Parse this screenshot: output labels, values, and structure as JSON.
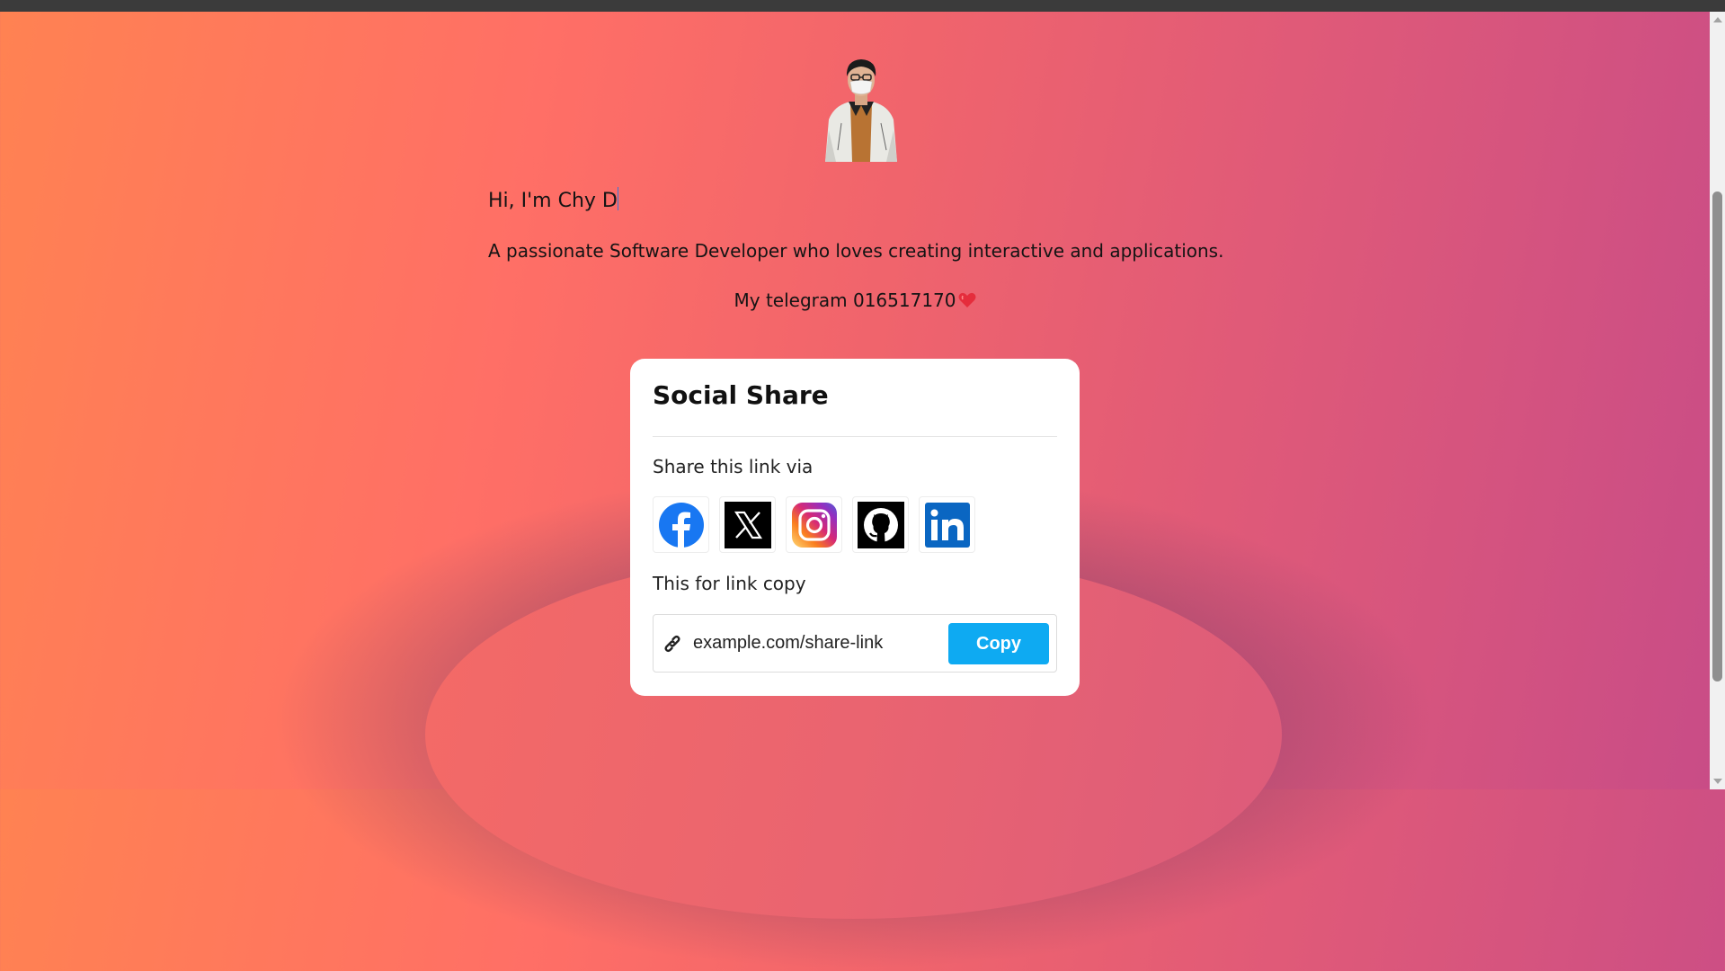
{
  "hero": {
    "greeting": "Hi, I'm Chy D",
    "bio": "A passionate Software Developer who loves creating interactive and applications.",
    "telegram": "My telegram 016517170"
  },
  "card": {
    "title": "Social Share",
    "share_label": "Share this link via",
    "icons": [
      "facebook-icon",
      "x-twitter-icon",
      "instagram-icon",
      "github-icon",
      "linkedin-icon"
    ],
    "copy_label": "This for link copy",
    "link_value": "example.com/share-link",
    "copy_button": "Copy"
  },
  "colors": {
    "facebook": "#1877f2",
    "linkedin": "#0a66c2",
    "copy_button": "#0eaaf2",
    "heart": "#e52d3c"
  }
}
